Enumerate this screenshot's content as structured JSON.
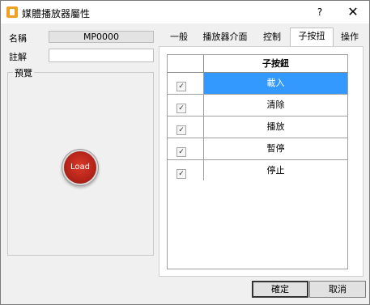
{
  "window": {
    "title": "媒體播放器屬性",
    "help_label": "?",
    "close_label": "✕"
  },
  "form": {
    "name_label": "名稱",
    "name_value": "MP0000",
    "comment_label": "註解",
    "comment_value": "",
    "preview_label": "預覽",
    "load_button_label": "Load"
  },
  "tabs": [
    {
      "label": "一般"
    },
    {
      "label": "播放器介面"
    },
    {
      "label": "控制"
    },
    {
      "label": "子按扭"
    },
    {
      "label": "操作"
    }
  ],
  "active_tab": "子按扭",
  "grid": {
    "header": "子按鈕",
    "rows": [
      {
        "label": "載入",
        "checked": true,
        "check_mark": "✓"
      },
      {
        "label": "清除",
        "checked": true,
        "check_mark": "✓"
      },
      {
        "label": "播放",
        "checked": true,
        "check_mark": "✓"
      },
      {
        "label": "暫停",
        "checked": true,
        "check_mark": "✓"
      },
      {
        "label": "停止",
        "checked": true,
        "check_mark": "✓"
      }
    ]
  },
  "footer": {
    "ok_label": "確定",
    "cancel_label": "取消"
  },
  "colors": {
    "selection": "#3399ff",
    "load_button": "#c0281c"
  }
}
